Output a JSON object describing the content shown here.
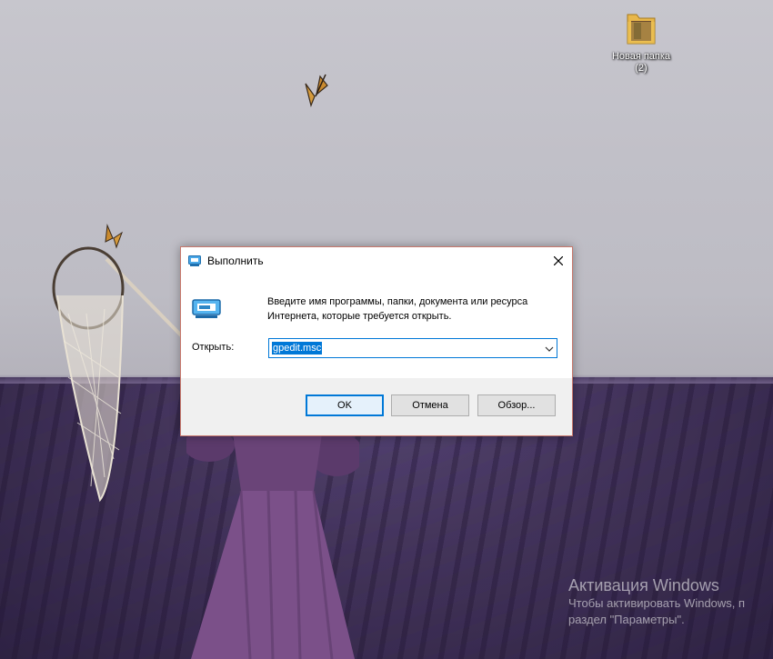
{
  "desktop": {
    "icons": [
      {
        "label_line1": "Новая папка",
        "label_line2": "(2)",
        "icon": "folder-icon"
      }
    ],
    "activation": {
      "title": "Активация Windows",
      "line1": "Чтобы активировать Windows, п",
      "line2": "раздел \"Параметры\"."
    }
  },
  "run_dialog": {
    "title": "Выполнить",
    "title_icon": "run-icon",
    "description": "Введите имя программы, папки, документа или ресурса Интернета, которые требуется открыть.",
    "open_label": "Открыть:",
    "open_value": "gpedit.msc",
    "buttons": {
      "ok": "OK",
      "cancel": "Отмена",
      "browse": "Обзор..."
    },
    "close_icon": "close-icon",
    "accent_color": "#0078d7"
  }
}
